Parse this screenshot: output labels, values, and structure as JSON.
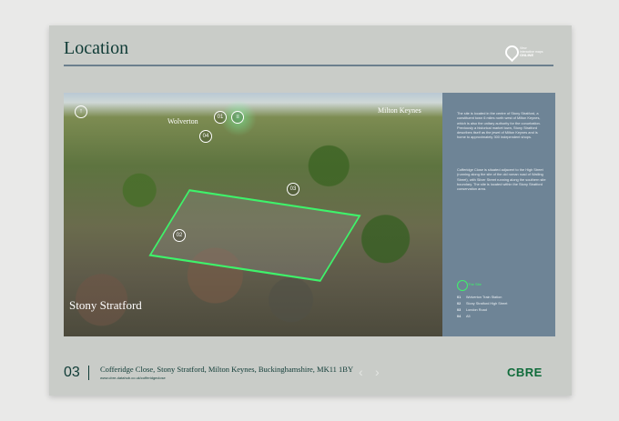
{
  "page": {
    "title": "Location",
    "badge": {
      "line1": "View",
      "line2": "interactive maps",
      "line3": "ONLINE"
    },
    "photo": {
      "labels": {
        "wolverton": "Wolverton",
        "milton_keynes": "Milton Keynes",
        "stony_stratford": "Stony Stratford"
      },
      "markers": [
        "01",
        "02",
        "03",
        "04"
      ]
    },
    "panel": {
      "para1": "The site is located in the centre of Stony Stratford, a constituent town 6 miles north west of Milton Keynes, which is also the unitary authority for the conurbation. Previously a historical market town, Stony Stratford describes itself as the jewel of Milton Keynes and is home to approximately 300 independent shops.",
      "para2": "Cofferidge Close is situated adjacent to the High Street (running along the site of the old roman road of Watling Street), with Silver Street running along the southern site boundary. The site is located within the Stony Stratford conservation area.",
      "key_label": "The Site",
      "key_items": [
        {
          "n": "01",
          "label": "Wolverton Train Station"
        },
        {
          "n": "02",
          "label": "Stony Stratford High Street"
        },
        {
          "n": "03",
          "label": "London Road"
        },
        {
          "n": "04",
          "label": "A5"
        }
      ]
    },
    "footer": {
      "page_number": "03",
      "address": "Cofferidge Close, Stony Stratford, Milton Keynes, Buckinghamshire, MK11 1BY",
      "url": "www.cbre-datahub.co.uk/cofferidgeclose",
      "prev": "‹",
      "next": "›",
      "logo": "CBRE"
    }
  },
  "colors": {
    "page_bg": "#c9ccc8",
    "panel_bg": "#6e8496",
    "brand_green": "#0f6b3a",
    "site_outline": "#3ef36a"
  }
}
